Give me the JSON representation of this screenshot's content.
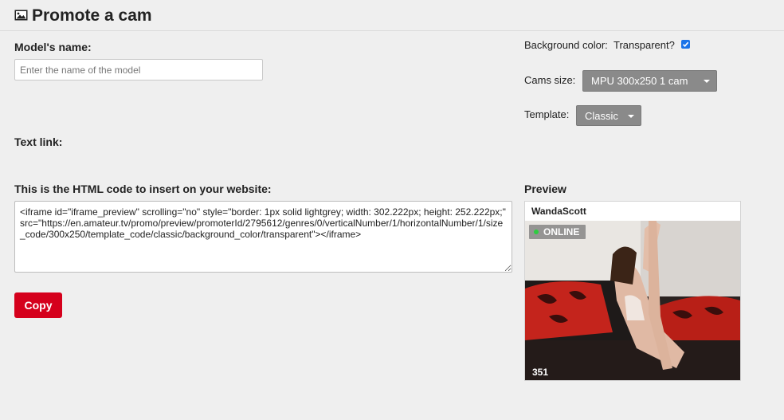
{
  "header": {
    "title": "Promote a cam",
    "icon": "image-icon"
  },
  "form": {
    "model_name_label": "Model's name:",
    "model_name_placeholder": "Enter the name of the model",
    "model_name_value": "",
    "text_link_label": "Text link:",
    "code_label": "This is the HTML code to insert on your website:",
    "code_value": "<iframe id=\"iframe_preview\" scrolling=\"no\" style=\"border: 1px solid lightgrey; width: 302.222px; height: 252.222px;\" src=\"https://en.amateur.tv/promo/preview/promoterId/2795612/genres/0/verticalNumber/1/horizontalNumber/1/size_code/300x250/template_code/classic/background_color/transparent\"></iframe>",
    "copy_label": "Copy"
  },
  "options": {
    "background_label": "Background color:",
    "transparent_label": "Transparent?",
    "transparent_checked": true,
    "cams_size_label": "Cams size:",
    "cams_size_value": "MPU 300x250 1 cam",
    "template_label": "Template:",
    "template_value": "Classic"
  },
  "preview": {
    "label": "Preview",
    "model_name": "WandaScott",
    "status": "ONLINE",
    "viewers": "351"
  },
  "colors": {
    "accent": "#d5001c",
    "select_bg": "#8a8a8a",
    "online_dot": "#2ecc40",
    "checkbox": "#1a73e8"
  }
}
